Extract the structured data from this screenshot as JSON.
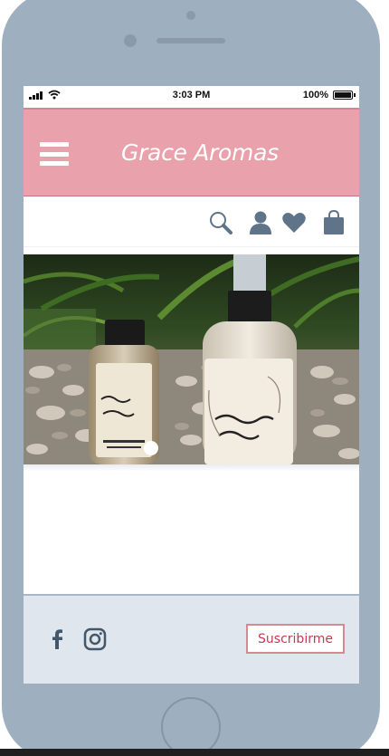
{
  "status_bar": {
    "time": "3:03 PM",
    "battery": "100%"
  },
  "header": {
    "brand": "Grace Aromas"
  },
  "toolbar": {
    "icons": [
      "search-icon",
      "user-icon",
      "heart-icon",
      "shopping-bag-icon"
    ]
  },
  "hero": {
    "carousel_active_index": 1,
    "carousel_count": 1
  },
  "footer": {
    "social_icons": [
      "facebook-icon",
      "instagram-icon"
    ],
    "subscribe_label": "Suscribirme"
  },
  "colors": {
    "header_bg": "#e9a1ab",
    "icon": "#5f7488",
    "footer_bg": "#dfe6ee",
    "accent_text": "#c33b54",
    "phone_frame": "#9eb0c0"
  }
}
